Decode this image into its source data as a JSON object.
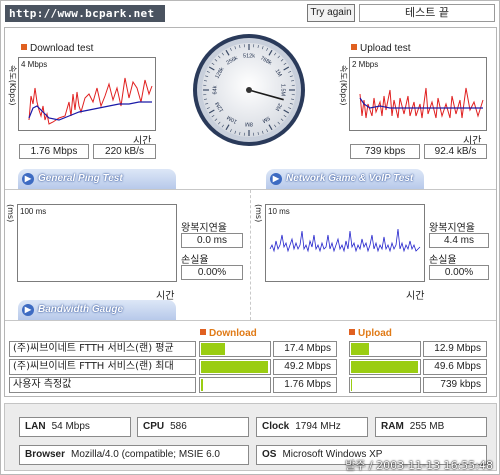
{
  "header": {
    "url": "http://www.bcpark.net",
    "try_again": "Try again",
    "end_label": "테스트 끝"
  },
  "download": {
    "title": "Download test",
    "scale": "4 Mbps",
    "ylabel": "속도(Kbps)",
    "xlabel": "시간",
    "value_mbps": "1.76 Mbps",
    "value_kbs": "220 kB/s"
  },
  "upload": {
    "title": "Upload test",
    "scale": "2 Mbps",
    "ylabel": "속도(Kbps)",
    "xlabel": "시간",
    "value_kbps": "739 kbps",
    "value_kbs": "92.4 kB/s"
  },
  "gauge": {
    "labels": [
      "128k",
      "256k",
      "512k",
      "768k",
      "1M",
      "1.5M",
      "2M",
      "5M",
      "8M",
      "10M",
      "12M",
      "64k"
    ],
    "needle_value": 1.76
  },
  "tabs": {
    "ping": "General Ping Test",
    "game": "Network Game & VoIP Test",
    "bandwidth": "Bandwidth Gauge"
  },
  "ping": {
    "scale": "100 ms",
    "ylabel": "(ms)",
    "xlabel": "시간",
    "rtt_label": "왕복지연율",
    "rtt_value": "0.0 ms",
    "loss_label": "손실율",
    "loss_value": "0.00%"
  },
  "game": {
    "scale": "10 ms",
    "ylabel": "(ms)",
    "xlabel": "시간",
    "rtt_label": "왕복지연율",
    "rtt_value": "4.4 ms",
    "loss_label": "손실율",
    "loss_value": "0.00%"
  },
  "bandwidth": {
    "download_header": "Download",
    "upload_header": "Upload",
    "rows": [
      {
        "name": "(주)씨브이네트 FTTH 서비스(랜) 평균",
        "down": "17.4 Mbps",
        "down_frac": 0.35,
        "up": "12.9 Mbps",
        "up_frac": 0.26
      },
      {
        "name": "(주)씨브이네트 FTTH 서비스(랜) 최대",
        "down": "49.2 Mbps",
        "down_frac": 0.98,
        "up": "49.6 Mbps",
        "up_frac": 0.99
      },
      {
        "name": "사용자 측정값",
        "down": "1.76 Mbps",
        "down_frac": 0.035,
        "up": "739 kbps",
        "up_frac": 0.015
      }
    ]
  },
  "system": {
    "lan_label": "LAN",
    "lan": "54 Mbps",
    "cpu_label": "CPU",
    "cpu": "586",
    "clock_label": "Clock",
    "clock": "1794 MHz",
    "ram_label": "RAM",
    "ram": "255 MB",
    "browser_label": "Browser",
    "browser": "Mozilla/4.0 (compatible; MSIE 6.0",
    "os_label": "OS",
    "os": "Microsoft Windows XP"
  },
  "timestamp": "발주 / 2003-11-13 16:55:48",
  "colors": {
    "download_line": "#e02020",
    "average_line": "#1a1aa8",
    "bar_fill": "#9acd12",
    "tab_blue": "#3d6bc2"
  }
}
